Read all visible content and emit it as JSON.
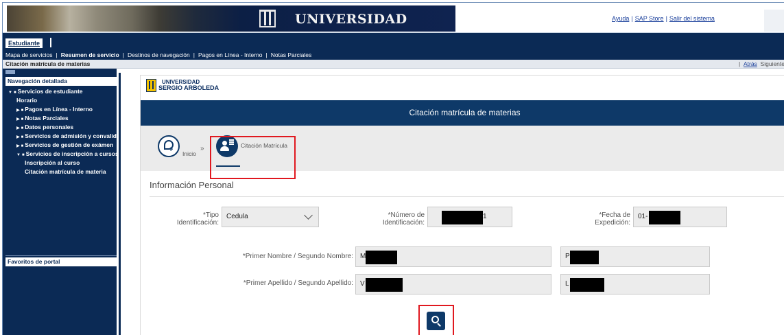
{
  "header": {
    "banner_title": "UNIVERSIDAD",
    "links": [
      "Ayuda",
      "SAP Store",
      "Salir del sistema"
    ]
  },
  "role": {
    "label": "Estudiante"
  },
  "nav": {
    "items": [
      "Mapa de servicios",
      "Resumen de servicio",
      "Destinos de navegación",
      "Pagos en Línea - Interno",
      "Notas Parciales"
    ]
  },
  "breadcrumb": {
    "page_title": "Citación matrícula de materias",
    "history_sep": "|",
    "back": "Atrás",
    "next": "Siguiente"
  },
  "sidebar": {
    "header": "Navegación detallada",
    "tree": [
      "Servicios de estudiante",
      "Horario",
      "Pagos en Línea - Interno",
      "Notas Parciales",
      "Datos personales",
      "Servicios de admisión y convalid",
      "Servicios de gestión de exámen",
      "Servicios de inscripción a cursos",
      "Inscripción al curso",
      "Citación matrícula de materia"
    ],
    "favorites_header": "Favoritos de portal"
  },
  "app": {
    "logo_line1": "UNIVERSIDAD",
    "logo_line2": "SERGIO ARBOLEDA",
    "title": "Citación matrícula de materias",
    "steps": [
      "Inicio",
      "Citación Matrícula"
    ],
    "arrow": "»",
    "section_title": "Información Personal"
  },
  "form": {
    "tipo_label": "*Tipo Identificación:",
    "tipo_value": "Cedula",
    "numero_label": "*Número de Identificación:",
    "numero_value": "1",
    "fecha_label": "*Fecha de Expedición:",
    "fecha_value": "01-",
    "nombre_label": "*Primer Nombre / Segundo Nombre:",
    "nombre1_value": "M",
    "nombre2_value": "P",
    "apellido_label": "*Primer Apellido / Segundo Apellido:",
    "apellido1_value": "V",
    "apellido2_value": "L"
  },
  "colors": {
    "navy": "#0b2a55",
    "title_bar": "#0e3968",
    "highlight": "#e0181f",
    "link": "#1a3f9b"
  },
  "icons": {
    "step1": "add-chat-icon",
    "step2": "user-document-icon",
    "search": "search-icon",
    "dropdown": "chevron-down-icon"
  }
}
